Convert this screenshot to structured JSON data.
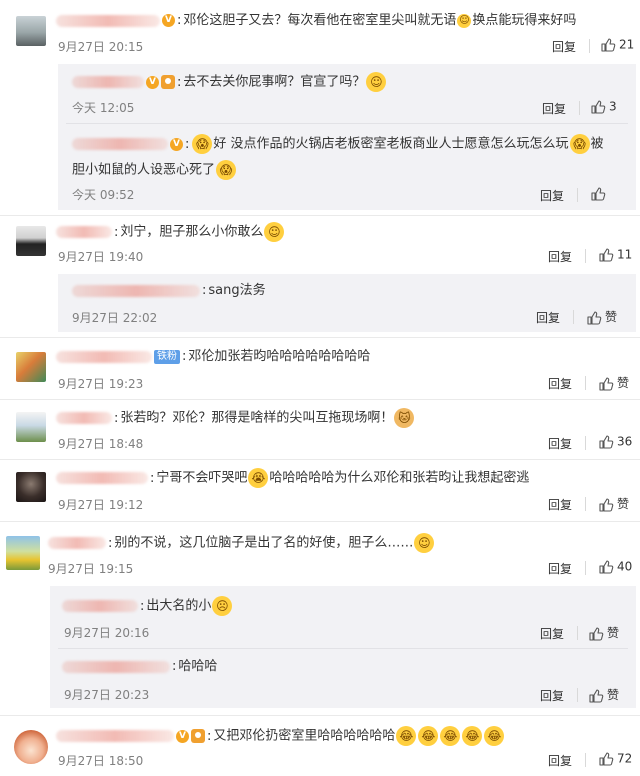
{
  "comments": [
    {
      "text_pre": "邓伦这胆子又去？每次看他在密室里尖叫就无语",
      "text_post": "换点能玩得来好吗",
      "time": "9月27日 20:15",
      "reply": "回复",
      "likes": "21",
      "replies": [
        {
          "text": "去不去关你屁事啊？官宣了吗？",
          "time": "今天 12:05",
          "reply": "回复",
          "likes": "3"
        },
        {
          "text_line1": "好 没点作品的火锅店老板密室老板商业人士愿意怎么玩怎么玩",
          "text_line1_tail": "被",
          "text_line2": "胆小如鼠的人设恶心死了",
          "time": "今天 09:52",
          "reply": "回复",
          "likes": ""
        }
      ]
    },
    {
      "text": "刘宁，胆子那么小你敢么",
      "time": "9月27日 19:40",
      "reply": "回复",
      "likes": "11",
      "replies": [
        {
          "text": "sang法务",
          "time": "9月27日 22:02",
          "reply": "回复",
          "likes": "赞"
        }
      ]
    },
    {
      "badge": "铁粉",
      "text": "邓伦加张若昀哈哈哈哈哈哈哈哈",
      "time": "9月27日 19:23",
      "reply": "回复",
      "likes": "赞"
    },
    {
      "text": "张若昀？邓伦？那得是啥样的尖叫互拖现场啊！",
      "time": "9月27日 18:48",
      "reply": "回复",
      "likes": "36"
    },
    {
      "text_pre": "宁哥不会吓哭吧",
      "text_post": "哈哈哈哈哈为什么邓伦和张若昀让我想起密逃",
      "time": "9月27日 19:12",
      "reply": "回复",
      "likes": "赞"
    },
    {
      "text": "别的不说，这几位脑子是出了名的好使，胆子么……",
      "time": "9月27日 19:15",
      "reply": "回复",
      "likes": "40",
      "replies": [
        {
          "text": "出大名的小",
          "time": "9月27日 20:16",
          "reply": "回复",
          "likes": "赞"
        },
        {
          "text": "哈哈哈",
          "time": "9月27日 20:23",
          "reply": "回复",
          "likes": "赞"
        }
      ]
    },
    {
      "text": "又把邓伦扔密室里哈哈哈哈哈哈",
      "time": "9月27日 18:50",
      "reply": "回复",
      "likes": "72"
    }
  ],
  "colors": {
    "accent": "#f5a623",
    "badge_blue": "#5e9fe8",
    "subbox": "#f2f2f5"
  },
  "icons": {
    "like": "thumbs-up-icon",
    "emoji": "face-emoji-icon"
  }
}
